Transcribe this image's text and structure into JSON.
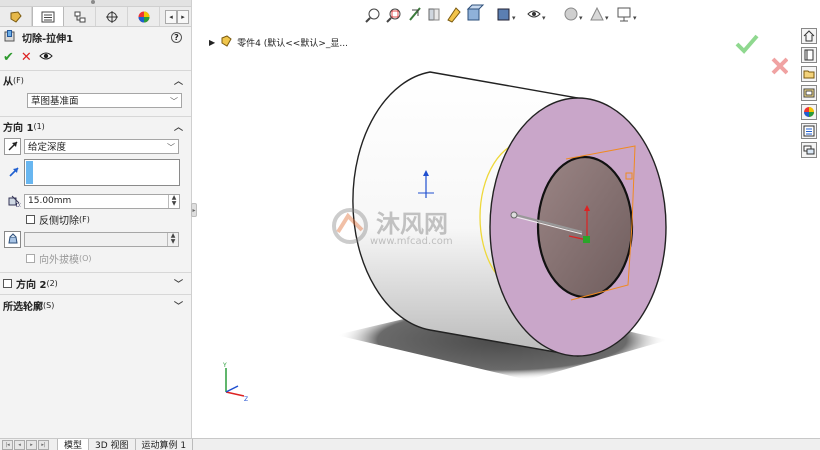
{
  "property_manager": {
    "feature_title": "切除-拉伸1",
    "help_label": "?",
    "from_group": {
      "label": "从",
      "shortcut": "(F)",
      "start_condition": "草图基准面"
    },
    "direction1_group": {
      "label": "方向 1",
      "shortcut": "(1)",
      "end_condition": "给定深度",
      "depth_value": "15.00mm",
      "flip_side_label": "反侧切除",
      "flip_side_shortcut": "(F)",
      "draft_outward_label": "向外拔模",
      "draft_outward_shortcut": "(O)"
    },
    "direction2_group": {
      "label": "方向 2",
      "shortcut": "(2)"
    },
    "selected_contours_group": {
      "label": "所选轮廓",
      "shortcut": "(S)"
    }
  },
  "viewport": {
    "breadcrumb_text": "零件4  (默认<<默认>_显...",
    "watermark_text": "沐风网",
    "watermark_url": "www.mfcad.com"
  },
  "bottom_tabs": [
    "模型",
    "3D 视图",
    "运动算例 1"
  ],
  "colors": {
    "ok_green": "#2e9a2e",
    "cancel_red": "#d22222",
    "cut_face_purple": "#c9a6c9",
    "selection_blue": "#68b6f0",
    "sketch_orange": "#f08a20"
  }
}
